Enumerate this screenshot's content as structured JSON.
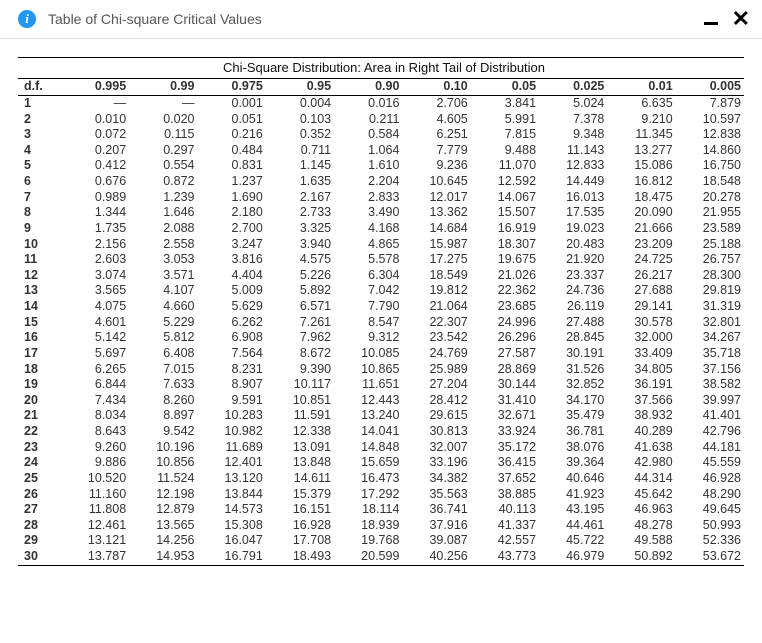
{
  "header": {
    "title": "Table of Chi-square Critical Values"
  },
  "chart_data": {
    "type": "table",
    "caption": "Chi-Square Distribution: Area in Right Tail of Distribution",
    "row_header": "d.f.",
    "columns": [
      "0.995",
      "0.99",
      "0.975",
      "0.95",
      "0.90",
      "0.10",
      "0.05",
      "0.025",
      "0.01",
      "0.005"
    ],
    "rows": [
      {
        "df": "1",
        "v": [
          "—",
          "—",
          "0.001",
          "0.004",
          "0.016",
          "2.706",
          "3.841",
          "5.024",
          "6.635",
          "7.879"
        ]
      },
      {
        "df": "2",
        "v": [
          "0.010",
          "0.020",
          "0.051",
          "0.103",
          "0.211",
          "4.605",
          "5.991",
          "7.378",
          "9.210",
          "10.597"
        ]
      },
      {
        "df": "3",
        "v": [
          "0.072",
          "0.115",
          "0.216",
          "0.352",
          "0.584",
          "6.251",
          "7.815",
          "9.348",
          "11.345",
          "12.838"
        ]
      },
      {
        "df": "4",
        "v": [
          "0.207",
          "0.297",
          "0.484",
          "0.711",
          "1.064",
          "7.779",
          "9.488",
          "11.143",
          "13.277",
          "14.860"
        ]
      },
      {
        "df": "5",
        "v": [
          "0.412",
          "0.554",
          "0.831",
          "1.145",
          "1.610",
          "9.236",
          "11.070",
          "12.833",
          "15.086",
          "16.750"
        ]
      },
      {
        "df": "6",
        "v": [
          "0.676",
          "0.872",
          "1.237",
          "1.635",
          "2.204",
          "10.645",
          "12.592",
          "14.449",
          "16.812",
          "18.548"
        ]
      },
      {
        "df": "7",
        "v": [
          "0.989",
          "1.239",
          "1.690",
          "2.167",
          "2.833",
          "12.017",
          "14.067",
          "16.013",
          "18.475",
          "20.278"
        ]
      },
      {
        "df": "8",
        "v": [
          "1.344",
          "1.646",
          "2.180",
          "2.733",
          "3.490",
          "13.362",
          "15.507",
          "17.535",
          "20.090",
          "21.955"
        ]
      },
      {
        "df": "9",
        "v": [
          "1.735",
          "2.088",
          "2.700",
          "3.325",
          "4.168",
          "14.684",
          "16.919",
          "19.023",
          "21.666",
          "23.589"
        ]
      },
      {
        "df": "10",
        "v": [
          "2.156",
          "2.558",
          "3.247",
          "3.940",
          "4.865",
          "15.987",
          "18.307",
          "20.483",
          "23.209",
          "25.188"
        ]
      },
      {
        "df": "11",
        "v": [
          "2.603",
          "3.053",
          "3.816",
          "4.575",
          "5.578",
          "17.275",
          "19.675",
          "21.920",
          "24.725",
          "26.757"
        ]
      },
      {
        "df": "12",
        "v": [
          "3.074",
          "3.571",
          "4.404",
          "5.226",
          "6.304",
          "18.549",
          "21.026",
          "23.337",
          "26.217",
          "28.300"
        ]
      },
      {
        "df": "13",
        "v": [
          "3.565",
          "4.107",
          "5.009",
          "5.892",
          "7.042",
          "19.812",
          "22.362",
          "24.736",
          "27.688",
          "29.819"
        ]
      },
      {
        "df": "14",
        "v": [
          "4.075",
          "4.660",
          "5.629",
          "6.571",
          "7.790",
          "21.064",
          "23.685",
          "26.119",
          "29.141",
          "31.319"
        ]
      },
      {
        "df": "15",
        "v": [
          "4.601",
          "5.229",
          "6.262",
          "7.261",
          "8.547",
          "22.307",
          "24.996",
          "27.488",
          "30.578",
          "32.801"
        ]
      },
      {
        "df": "16",
        "v": [
          "5.142",
          "5.812",
          "6.908",
          "7.962",
          "9.312",
          "23.542",
          "26.296",
          "28.845",
          "32.000",
          "34.267"
        ]
      },
      {
        "df": "17",
        "v": [
          "5.697",
          "6.408",
          "7.564",
          "8.672",
          "10.085",
          "24.769",
          "27.587",
          "30.191",
          "33.409",
          "35.718"
        ]
      },
      {
        "df": "18",
        "v": [
          "6.265",
          "7.015",
          "8.231",
          "9.390",
          "10.865",
          "25.989",
          "28.869",
          "31.526",
          "34.805",
          "37.156"
        ]
      },
      {
        "df": "19",
        "v": [
          "6.844",
          "7.633",
          "8.907",
          "10.117",
          "11.651",
          "27.204",
          "30.144",
          "32.852",
          "36.191",
          "38.582"
        ]
      },
      {
        "df": "20",
        "v": [
          "7.434",
          "8.260",
          "9.591",
          "10.851",
          "12.443",
          "28.412",
          "31.410",
          "34.170",
          "37.566",
          "39.997"
        ]
      },
      {
        "df": "21",
        "v": [
          "8.034",
          "8.897",
          "10.283",
          "11.591",
          "13.240",
          "29.615",
          "32.671",
          "35.479",
          "38.932",
          "41.401"
        ]
      },
      {
        "df": "22",
        "v": [
          "8.643",
          "9.542",
          "10.982",
          "12.338",
          "14.041",
          "30.813",
          "33.924",
          "36.781",
          "40.289",
          "42.796"
        ]
      },
      {
        "df": "23",
        "v": [
          "9.260",
          "10.196",
          "11.689",
          "13.091",
          "14.848",
          "32.007",
          "35.172",
          "38.076",
          "41.638",
          "44.181"
        ]
      },
      {
        "df": "24",
        "v": [
          "9.886",
          "10.856",
          "12.401",
          "13.848",
          "15.659",
          "33.196",
          "36.415",
          "39.364",
          "42.980",
          "45.559"
        ]
      },
      {
        "df": "25",
        "v": [
          "10.520",
          "11.524",
          "13.120",
          "14.611",
          "16.473",
          "34.382",
          "37.652",
          "40.646",
          "44.314",
          "46.928"
        ]
      },
      {
        "df": "26",
        "v": [
          "11.160",
          "12.198",
          "13.844",
          "15.379",
          "17.292",
          "35.563",
          "38.885",
          "41.923",
          "45.642",
          "48.290"
        ]
      },
      {
        "df": "27",
        "v": [
          "11.808",
          "12.879",
          "14.573",
          "16.151",
          "18.114",
          "36.741",
          "40.113",
          "43.195",
          "46.963",
          "49.645"
        ]
      },
      {
        "df": "28",
        "v": [
          "12.461",
          "13.565",
          "15.308",
          "16.928",
          "18.939",
          "37.916",
          "41.337",
          "44.461",
          "48.278",
          "50.993"
        ]
      },
      {
        "df": "29",
        "v": [
          "13.121",
          "14.256",
          "16.047",
          "17.708",
          "19.768",
          "39.087",
          "42.557",
          "45.722",
          "49.588",
          "52.336"
        ]
      },
      {
        "df": "30",
        "v": [
          "13.787",
          "14.953",
          "16.791",
          "18.493",
          "20.599",
          "40.256",
          "43.773",
          "46.979",
          "50.892",
          "53.672"
        ]
      }
    ]
  }
}
